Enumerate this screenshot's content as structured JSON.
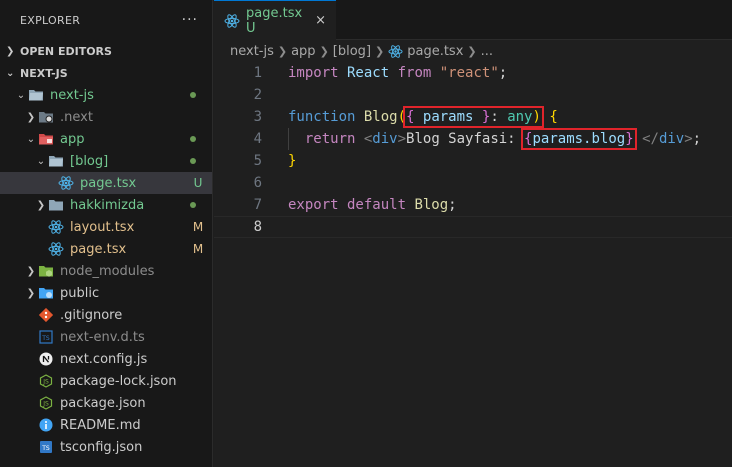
{
  "sidebar": {
    "title": "EXPLORER",
    "more": "···",
    "open_editors": "OPEN EDITORS",
    "project": "NEXT-JS",
    "tree": [
      {
        "label": "next-js",
        "badge": ""
      },
      {
        "label": ".next",
        "badge": ""
      },
      {
        "label": "app",
        "badge": ""
      },
      {
        "label": "[blog]",
        "badge": ""
      },
      {
        "label": "page.tsx",
        "badge": "U"
      },
      {
        "label": "hakkimizda",
        "badge": ""
      },
      {
        "label": "layout.tsx",
        "badge": "M"
      },
      {
        "label": "page.tsx",
        "badge": "M"
      },
      {
        "label": "node_modules",
        "badge": ""
      },
      {
        "label": "public",
        "badge": ""
      },
      {
        "label": ".gitignore",
        "badge": ""
      },
      {
        "label": "next-env.d.ts",
        "badge": ""
      },
      {
        "label": "next.config.js",
        "badge": ""
      },
      {
        "label": "package-lock.json",
        "badge": ""
      },
      {
        "label": "package.json",
        "badge": ""
      },
      {
        "label": "README.md",
        "badge": ""
      },
      {
        "label": "tsconfig.json",
        "badge": ""
      }
    ]
  },
  "editor": {
    "tab": {
      "name": "page.tsx",
      "status": "U",
      "close": "×"
    },
    "breadcrumb": {
      "p1": "next-js",
      "p2": "app",
      "p3": "[blog]",
      "p4": "page.tsx",
      "p5": "..."
    },
    "lines": {
      "l1": {
        "n": "1",
        "kw": "import",
        "cls": " React ",
        "from": "from",
        "str": " \"react\"",
        "semi": ";"
      },
      "l2": {
        "n": "2"
      },
      "l3": {
        "n": "3",
        "kw": "function",
        "fn": " Blog",
        "p1": "(",
        "b1": "{",
        "param": " params ",
        "b1c": "}",
        "colon": ": ",
        "any": "any",
        "p1c": ")",
        "sp": " ",
        "b2": "{"
      },
      "l4": {
        "n": "4",
        "kw": "  return",
        "lt": " <",
        "tag": "div",
        "gt": ">",
        "txt": "Blog Sayfasi: ",
        "b3": "{",
        "expr": "params.blog",
        "b3c": "}",
        "lt2": " </",
        "tag2": "div",
        "gt2": ">",
        "semi": ";"
      },
      "l5": {
        "n": "5",
        "b": "}"
      },
      "l6": {
        "n": "6"
      },
      "l7": {
        "n": "7",
        "kw": "export",
        "kw2": " default",
        "name": " Blog",
        "semi": ";"
      },
      "l8": {
        "n": "8"
      }
    }
  }
}
